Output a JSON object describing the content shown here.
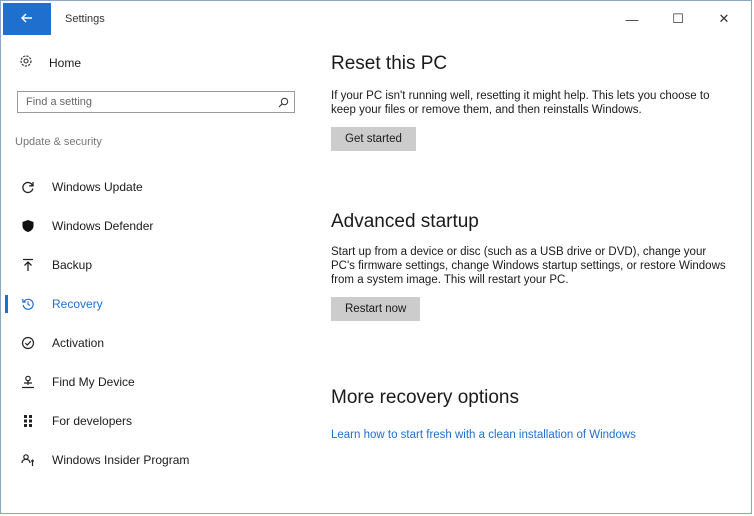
{
  "window": {
    "title": "Settings",
    "controls": {
      "minimize": "—",
      "maximize": "☐",
      "close": "✕"
    }
  },
  "sidebar": {
    "home_label": "Home",
    "search_placeholder": "Find a setting",
    "section_title": "Update & security",
    "items": [
      {
        "label": "Windows Update",
        "icon": "refresh-icon"
      },
      {
        "label": "Windows Defender",
        "icon": "shield-icon"
      },
      {
        "label": "Backup",
        "icon": "backup-arrow-icon"
      },
      {
        "label": "Recovery",
        "icon": "recovery-icon",
        "selected": true
      },
      {
        "label": "Activation",
        "icon": "check-circle-icon"
      },
      {
        "label": "Find My Device",
        "icon": "person-location-icon"
      },
      {
        "label": "For developers",
        "icon": "developer-icon"
      },
      {
        "label": "Windows Insider Program",
        "icon": "insider-icon"
      }
    ]
  },
  "main": {
    "reset": {
      "heading": "Reset this PC",
      "description": "If your PC isn't running well, resetting it might help. This lets you choose to keep your files or remove them, and then reinstalls Windows.",
      "button": "Get started"
    },
    "advanced": {
      "heading": "Advanced startup",
      "description": "Start up from a device or disc (such as a USB drive or DVD), change your PC's firmware settings, change Windows startup settings, or restore Windows from a system image. This will restart your PC.",
      "button": "Restart now"
    },
    "more": {
      "heading": "More recovery options",
      "link": "Learn how to start fresh with a clean installation of Windows"
    }
  },
  "colors": {
    "accent": "#1f6fcf",
    "button_bg": "#cccccc"
  }
}
